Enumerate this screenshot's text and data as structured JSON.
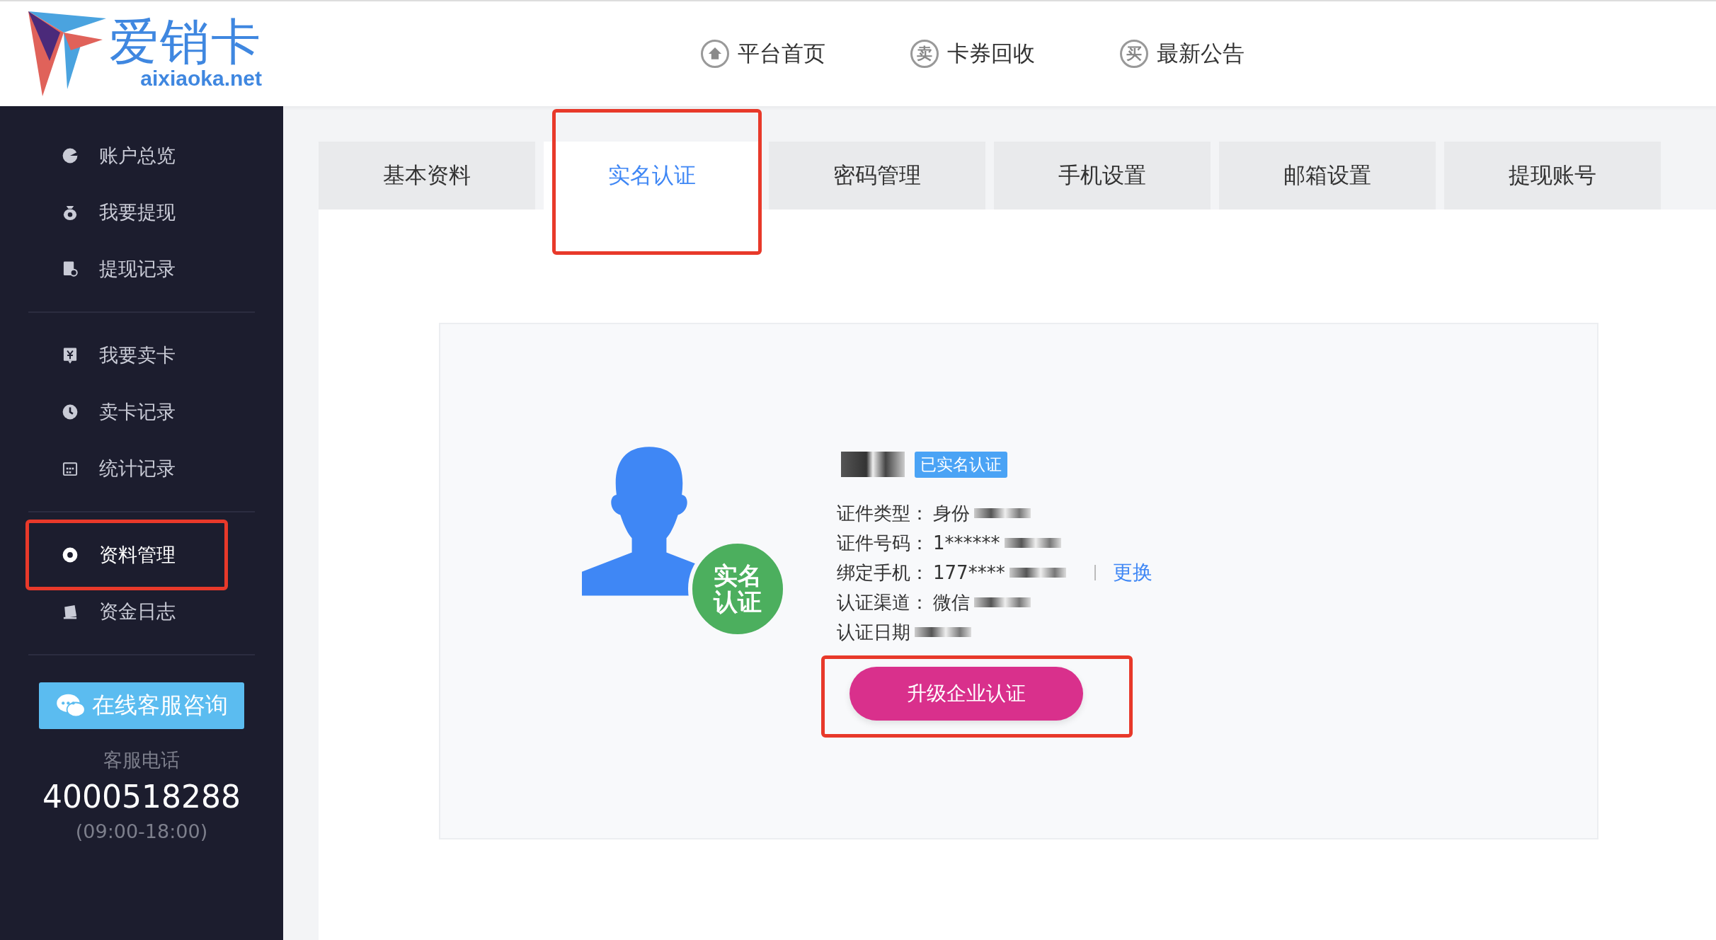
{
  "header": {
    "logo": {
      "name": "爱销卡",
      "domain": "aixiaoka.net"
    },
    "nav": [
      {
        "label": "平台首页"
      },
      {
        "label": "卡券回收",
        "glyph": "卖"
      },
      {
        "label": "最新公告",
        "glyph": "买"
      }
    ]
  },
  "sidebar": {
    "groups": [
      [
        {
          "label": "账户总览",
          "selected": false,
          "highlighted": false
        },
        {
          "label": "我要提现",
          "selected": false,
          "highlighted": false
        },
        {
          "label": "提现记录",
          "selected": false,
          "highlighted": false
        }
      ],
      [
        {
          "label": "我要卖卡",
          "selected": false,
          "highlighted": false
        },
        {
          "label": "卖卡记录",
          "selected": false,
          "highlighted": false
        },
        {
          "label": "统计记录",
          "selected": false,
          "highlighted": false
        }
      ],
      [
        {
          "label": "资料管理",
          "selected": true,
          "highlighted": true
        },
        {
          "label": "资金日志",
          "selected": false,
          "highlighted": false
        }
      ]
    ],
    "support_button": "在线客服咨询",
    "phone_label": "客服电话",
    "phone": "4000518288",
    "hours": "(09:00-18:00)"
  },
  "tabs": [
    {
      "label": "基本资料",
      "selected": false,
      "highlighted": false
    },
    {
      "label": "实名认证",
      "selected": true,
      "highlighted": true
    },
    {
      "label": "密码管理",
      "selected": false,
      "highlighted": false
    },
    {
      "label": "手机设置",
      "selected": false,
      "highlighted": false
    },
    {
      "label": "邮箱设置",
      "selected": false,
      "highlighted": false
    },
    {
      "label": "提现账号",
      "selected": false,
      "highlighted": false
    }
  ],
  "profile": {
    "avatar_badge": "实名认证",
    "name_redacted": true,
    "verified_badge": "已实名认证",
    "fields": [
      {
        "label": "证件类型：",
        "value": "身份",
        "redacted": true
      },
      {
        "label": "证件号码：",
        "value": "1******",
        "redacted": true
      },
      {
        "label": "绑定手机：",
        "value": "177****",
        "redacted": true,
        "link": "更换"
      },
      {
        "label": "认证渠道：",
        "value": "微信",
        "redacted": true
      },
      {
        "label": "认证日期",
        "redacted": true
      }
    ],
    "upgrade_button": "升级企业认证",
    "upgrade_highlighted": true
  }
}
